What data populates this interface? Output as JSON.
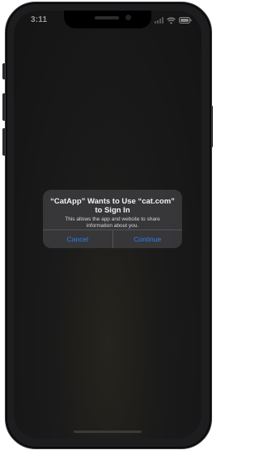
{
  "status_bar": {
    "time": "3:11"
  },
  "alert": {
    "title": "“CatApp” Wants to Use “cat.com” to Sign In",
    "message": "This allows the app and website to share information about you.",
    "cancel_label": "Cancel",
    "continue_label": "Continue"
  },
  "colors": {
    "accent": "#2f7cf0",
    "alert_background": "#3a3a3c",
    "screen_background": "#161616"
  },
  "icons": [
    "signal-icon",
    "wifi-icon",
    "battery-icon"
  ]
}
